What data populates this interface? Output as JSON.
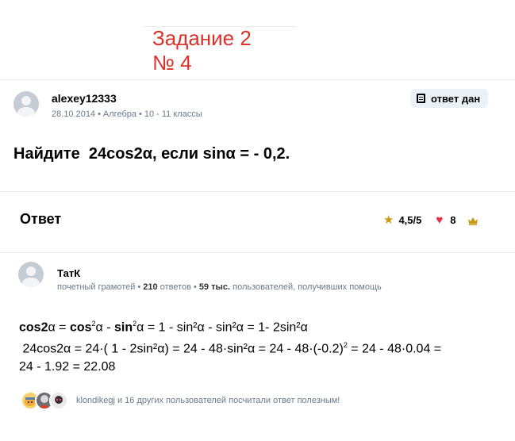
{
  "task_label": {
    "line1": "Задание 2",
    "line2": "№ 4"
  },
  "question": {
    "author": "alexey12333",
    "date": "28.10.2014",
    "subject": "Алгебра",
    "grade": "10 - 11 классы",
    "answered_badge": "ответ дан",
    "text": "Найдите  24cos2α, если sinα = - 0,2."
  },
  "answer_header": {
    "title": "Ответ",
    "rating": "4,5/5",
    "likes": "8"
  },
  "answer": {
    "author": "ТатК",
    "role": "почетный грамотей",
    "answers_count": "210",
    "answers_label": "ответов",
    "helped_count": "59 тыс.",
    "helped_label": "пользователей, получивших помощь",
    "line1": {
      "b1": "cos2",
      "t1": "α = ",
      "b2": "cos",
      "s1": "2",
      "t2": "α - ",
      "b3": "sin",
      "s2": "2",
      "t3": "α = 1 - sin²α - sin²α = 1- 2sin²α"
    },
    "line2": {
      "t1": " 24cos2α = 24·( 1 - 2sin²α) = 24 - 48·sin²α = 24 - 48·(-0.2)",
      "s1": "2",
      "t2": " = 24 - 48·0.04 ="
    },
    "line3": "24 - 1.92 = 22.08"
  },
  "helpers": {
    "text": "klondikegj и 16 других пользователей посчитали ответ полезным!"
  },
  "colors": {
    "accent_red": "#d9322b",
    "badge_bg": "#ebf2f7",
    "meta_gray": "#687b8c",
    "star": "#c99a0f",
    "heart": "#e8304a",
    "crown": "#c99a0f"
  }
}
